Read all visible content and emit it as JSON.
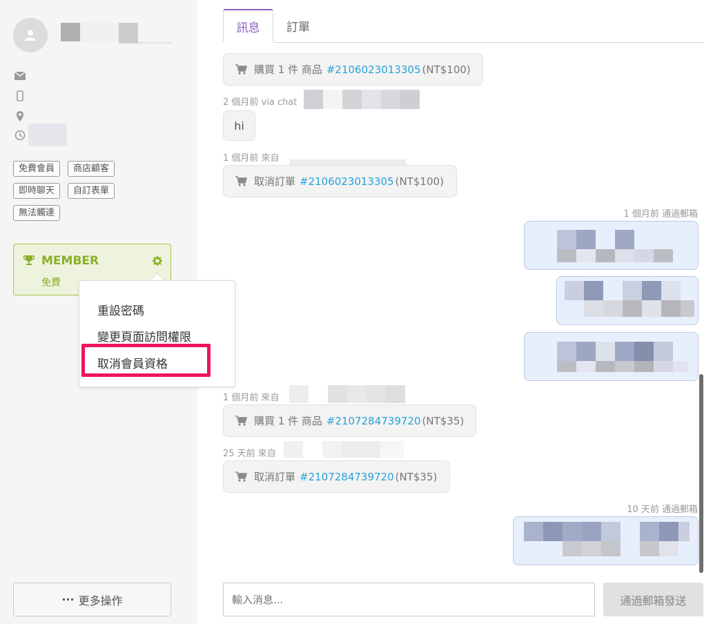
{
  "sidebar": {
    "tags": [
      "免費會員",
      "商店顧客",
      "即時聊天",
      "自訂表單",
      "無法觸達"
    ],
    "member": {
      "title": "MEMBER",
      "subtitle": "免費"
    },
    "menu": {
      "items": [
        "重設密碼",
        "變更頁面訪問權限",
        "取消會員資格"
      ]
    },
    "more_button": "更多操作"
  },
  "tabs": [
    "訊息",
    "訂單"
  ],
  "messages": [
    {
      "action": "購買 1 件 商品",
      "order": "#2106023013305",
      "amount": "(NT$100)"
    },
    {
      "meta": "2 個月前 via chat",
      "text": "hi"
    },
    {
      "meta": "1 個月前 來自",
      "action": "取消訂單",
      "order": "#2106023013305",
      "amount": "(NT$100)"
    },
    {
      "meta": "1 個月前 通過郵箱"
    },
    {
      "meta": "1 個月前 來自",
      "action": "購買 1 件 商品",
      "order": "#2107284739720",
      "amount": "(NT$35)"
    },
    {
      "meta": "25 天前 來自",
      "action": "取消訂單",
      "order": "#2107284739720",
      "amount": "(NT$35)"
    },
    {
      "meta": "10 天前 通過郵箱"
    }
  ],
  "composer": {
    "placeholder": "輸入消息...",
    "send_label": "通過郵箱發送"
  },
  "colors": {
    "accent": "#8b5fc4",
    "link": "#27a2d8",
    "member_green": "#8ab02a",
    "highlight": "#f0145a"
  },
  "icons": [
    "user-icon",
    "mail-icon",
    "phone-icon",
    "location-icon",
    "clock-icon",
    "trophy-icon",
    "gear-icon",
    "cart-icon"
  ]
}
